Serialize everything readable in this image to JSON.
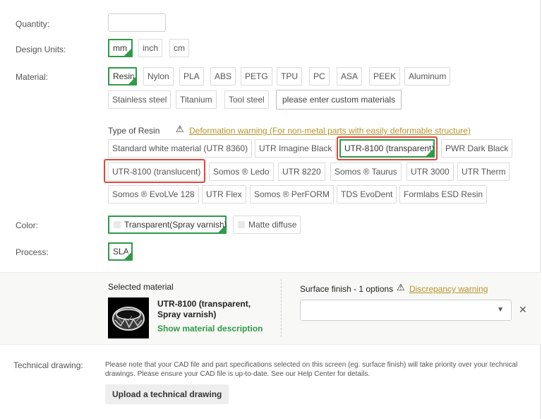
{
  "labels": {
    "quantity": "Quantity:",
    "design_units": "Design Units:",
    "material": "Material:",
    "color": "Color:",
    "process": "Process:"
  },
  "quantity_value": "",
  "units": [
    "mm",
    "inch",
    "cm"
  ],
  "materials": [
    "Resin",
    "Nylon",
    "PLA",
    "ABS",
    "PETG",
    "TPU",
    "PC",
    "ASA",
    "PEEK",
    "Aluminum",
    "Stainless steel",
    "Titanium",
    "Tool steel"
  ],
  "custom_material_label": "please enter custom materials",
  "type_of_resin_label": "Type of Resin",
  "deformation_warning": "Deformation warning (For non-metal parts with easily deformable structure)",
  "resins": [
    "Standard white material (UTR 8360)",
    "UTR Imagine Black",
    "UTR-8100 (transparent)",
    "PWR Dark Black",
    "UTR-8100 (translucent)",
    "Somos ® Ledo",
    "UTR 8220",
    "Somos ® Taurus",
    "UTR 3000",
    "UTR Therm",
    "Somos ® EvoLVe 128",
    "UTR Flex",
    "Somos ® PerFORM",
    "TDS EvoDent",
    "Formlabs ESD Resin"
  ],
  "colors": [
    "Transparent(Spray varnish)",
    "Matte diffuse"
  ],
  "processes": [
    "SLA"
  ],
  "selected": {
    "unit": "mm",
    "material": "Resin",
    "resin": "UTR-8100 (transparent)",
    "color": "Transparent(Spray varnish)",
    "process": "SLA"
  },
  "selected_panel": {
    "title": "Selected material",
    "name_line1": "UTR-8100 (transparent,",
    "name_line2": "Spray varnish)",
    "show_description": "Show material description"
  },
  "surface_finish": {
    "title": "Surface finish - 1 options",
    "warning": "Discrepancy warning",
    "value": ""
  },
  "technical_drawing": {
    "label": "Technical drawing:",
    "note": "Please note that your CAD file and part specifications selected on this screen (eg. surface finish) will take priority over your technical drawings. Please ensure your CAD file is up-to-date. See our Help Center for details.",
    "button": "Upload a technical drawing"
  },
  "colors_theme": {
    "accent_green": "#2e9a4a",
    "highlight_red": "#e0463c",
    "warning_gold": "#b9932b"
  }
}
